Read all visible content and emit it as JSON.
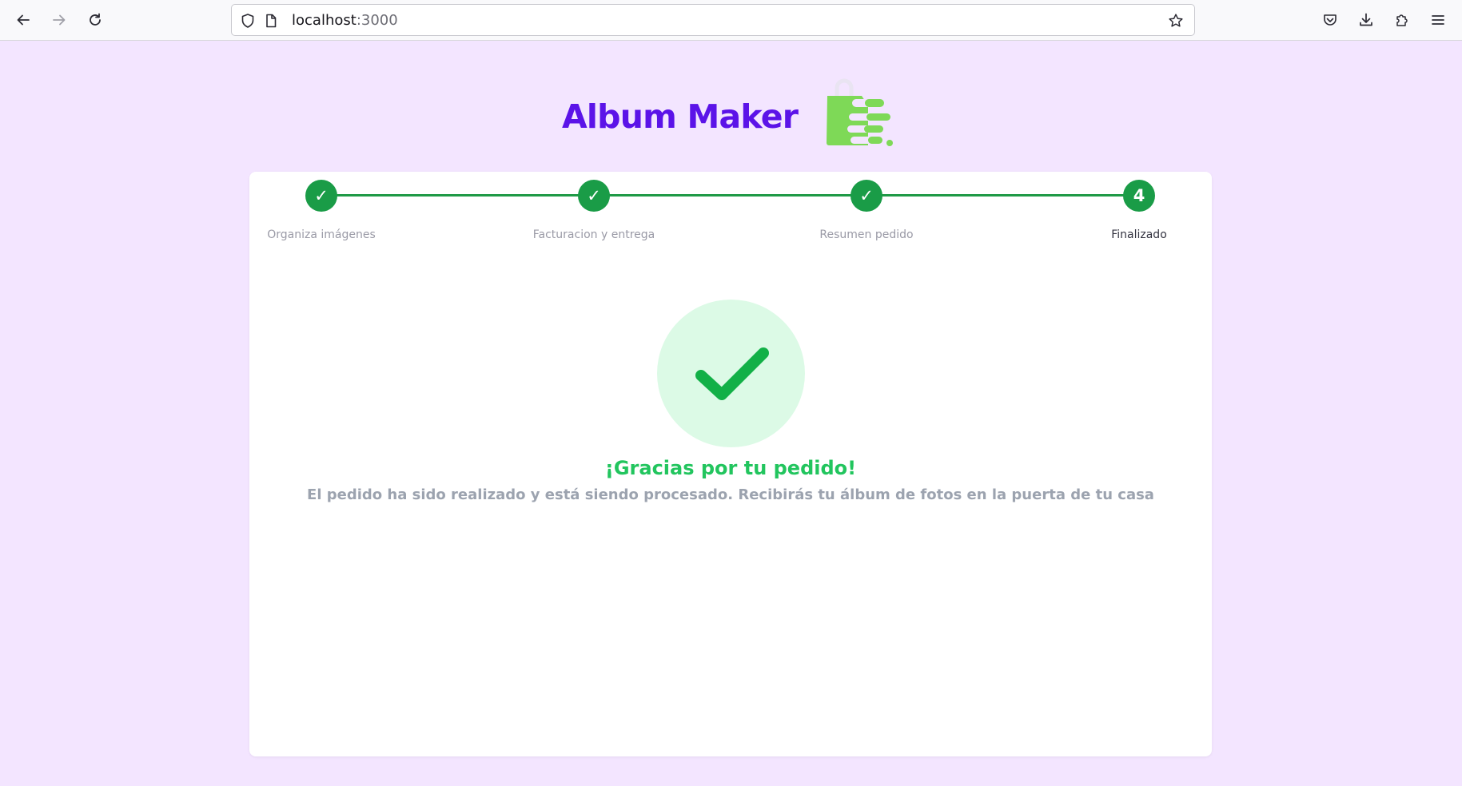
{
  "browser": {
    "url_host": "localhost",
    "url_port": ":3000",
    "icons": [
      "back-arrow-icon",
      "forward-arrow-icon",
      "reload-icon",
      "shield-icon",
      "page-icon",
      "star-icon",
      "pocket-icon",
      "download-icon",
      "extensions-icon",
      "menu-icon"
    ]
  },
  "brand": {
    "title": "Album Maker",
    "title_color": "#5b13e8",
    "logo_color": "#7ed957"
  },
  "stepper": {
    "completed_color": "#1a9c47",
    "steps": [
      {
        "label": "Organiza imágenes",
        "marker": "✓",
        "state": "done"
      },
      {
        "label": "Facturacion y entrega",
        "marker": "✓",
        "state": "done"
      },
      {
        "label": "Resumen pedido",
        "marker": "✓",
        "state": "done"
      },
      {
        "label": "Finalizado",
        "marker": "4",
        "state": "active"
      }
    ]
  },
  "confirmation": {
    "icon": "check-icon",
    "title": "¡Gracias por tu pedido!",
    "message": "El pedido ha sido realizado y está siendo procesado. Recibirás tu álbum de fotos en la puerta de tu casa",
    "title_color": "#22c55e",
    "icon_color": "#12b047"
  }
}
